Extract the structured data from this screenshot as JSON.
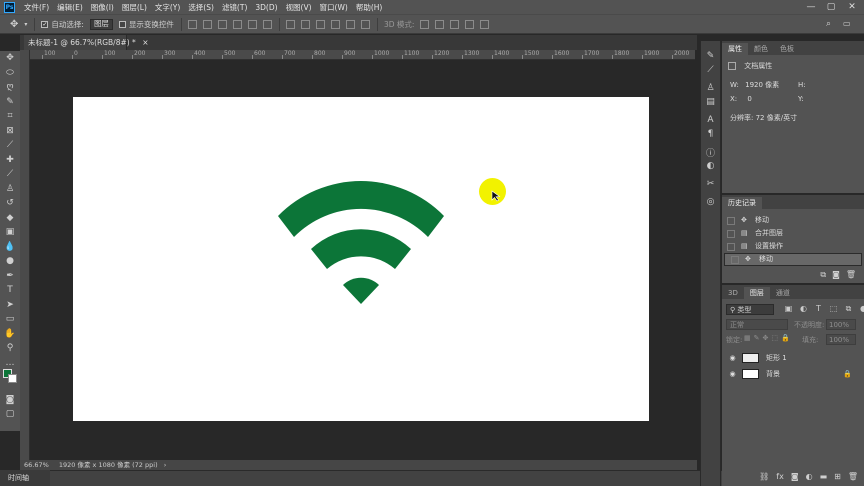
{
  "menubar": {
    "items": [
      "文件(F)",
      "编辑(E)",
      "图像(I)",
      "图层(L)",
      "文字(Y)",
      "选择(S)",
      "滤镜(T)",
      "3D(D)",
      "视图(V)",
      "窗口(W)",
      "帮助(H)"
    ],
    "logo": "Ps",
    "minimize": "—",
    "restore": "▢",
    "close": "✕"
  },
  "options": {
    "auto_select_label": "自动选择:",
    "auto_select_value": "图层",
    "show_transform_label": "显示变换控件",
    "mode_3d_label": "3D 模式:"
  },
  "document": {
    "tab_title": "未标题-1 @ 66.7%(RGB/8#) *",
    "close_glyph": "×"
  },
  "ruler": {
    "h_ticks": [
      "100",
      "0",
      "100",
      "200",
      "300",
      "400",
      "500",
      "600",
      "700",
      "800",
      "900",
      "1000",
      "1100",
      "1200",
      "1300",
      "1400",
      "1500",
      "1600",
      "1700",
      "1800",
      "1900",
      "2000"
    ]
  },
  "status": {
    "zoom": "66.67%",
    "info": "1920 像素 x 1080 像素 (72 ppi)"
  },
  "timeline": {
    "label": "时间轴"
  },
  "properties": {
    "tabs": [
      "属性",
      "颜色",
      "色板"
    ],
    "section": "文档属性",
    "w_label": "W:",
    "w_value": "1920 像素",
    "h_label": "H:",
    "x_label": "X:",
    "x_value": "0",
    "y_label": "Y:",
    "resolution": "分辨率: 72 像素/英寸"
  },
  "history": {
    "tab": "历史记录",
    "items": [
      {
        "label": "移动",
        "icon": "move-icon"
      },
      {
        "label": "合并图层",
        "icon": "doc-icon"
      },
      {
        "label": "设置操作",
        "icon": "doc-icon"
      },
      {
        "label": "移动",
        "icon": "move-icon"
      }
    ]
  },
  "layers": {
    "tabs": [
      "3D",
      "图层",
      "通道"
    ],
    "filter_label": "类型",
    "blend_mode": "正常",
    "opacity_label": "不透明度:",
    "opacity_value": "100%",
    "lock_label": "锁定:",
    "fill_label": "填充:",
    "fill_value": "100%",
    "items": [
      {
        "name": "矩形 1",
        "visible": true
      },
      {
        "name": "背景",
        "visible": true,
        "locked": true
      }
    ]
  },
  "colors": {
    "wifi_green": "#0c7538",
    "cursor_highlight": "#f2f200",
    "canvas": "#ffffff"
  }
}
